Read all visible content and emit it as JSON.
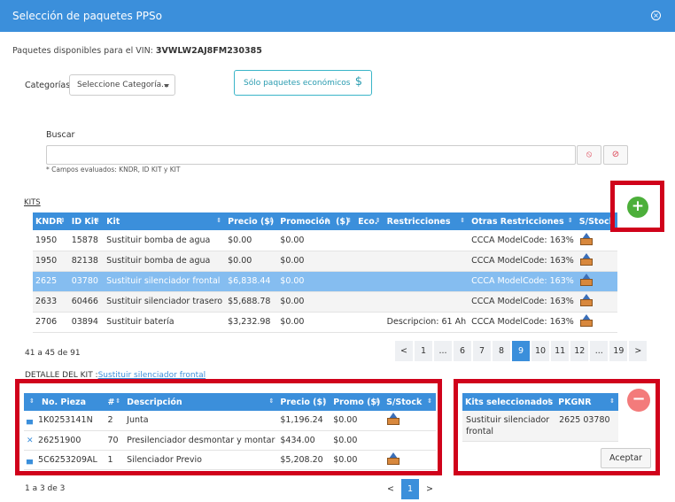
{
  "header": {
    "title": "Selección de paquetes PPSo",
    "close_glyph": "×"
  },
  "vin": {
    "label": "Paquetes disponibles para el VIN:",
    "value": "3VWLW2AJ8FM230385"
  },
  "categorias": {
    "label": "Categorías",
    "placeholder": "Seleccione Categoría..."
  },
  "eco_button": {
    "label": "Sólo paquetes económicos",
    "icon": "dollar-icon"
  },
  "buscar": {
    "label": "Buscar",
    "note": "* Campos evaluados: KNDR, ID KIT y KIT",
    "clear_glyph": "⦸",
    "cancel_glyph": "⊘"
  },
  "kits": {
    "label": "KITS",
    "columns": [
      "KNDR",
      "ID Kit",
      "Kit",
      "Precio ($)",
      "Promoción",
      "($)",
      "Eco.",
      "Restricciones",
      "Otras Restricciones",
      "S/Stock"
    ],
    "rows": [
      [
        "1950",
        "15878",
        "Sustituir bomba de agua",
        "$0.00",
        "$0.00",
        "",
        "",
        "",
        "CCCA ModelCode: 163%"
      ],
      [
        "1950",
        "82138",
        "Sustituir bomba de agua",
        "$0.00",
        "$0.00",
        "",
        "",
        "",
        "CCCA ModelCode: 163%"
      ],
      [
        "2625",
        "03780",
        "Sustituir silenciador frontal",
        "$6,838.44",
        "$0.00",
        "",
        "",
        "",
        "CCCA ModelCode: 163%"
      ],
      [
        "2633",
        "60466",
        "Sustituir silenciador trasero",
        "$5,688.78",
        "$0.00",
        "",
        "",
        "",
        "CCCA ModelCode: 163%"
      ],
      [
        "2706",
        "03894",
        "Sustituir batería",
        "$3,232.98",
        "$0.00",
        "",
        "",
        "Descripcion: 61 Ah",
        "CCCA ModelCode: 163%"
      ]
    ],
    "selected_row": 2,
    "count": "41 a 45 de 91",
    "pages": [
      "<",
      "1",
      "...",
      "6",
      "7",
      "8",
      "9",
      "10",
      "11",
      "12",
      "...",
      "19",
      ">"
    ],
    "active_page": "9",
    "add_glyph": "+"
  },
  "detalle": {
    "label": "DETALLE DEL KIT :",
    "kit_name": "Sustituir silenciador frontal",
    "columns": [
      "No. Pieza",
      "#",
      "Descripción",
      "Precio ($)",
      "Promo ($)",
      "S/Stock"
    ],
    "rows": [
      {
        "icon": "engine-icon",
        "pieza": "1K0253141N",
        "qty": "2",
        "desc": "Junta",
        "precio": "$1,196.24",
        "promo": "$0.00",
        "stock": true
      },
      {
        "icon": "tools-icon",
        "pieza": "26251900",
        "qty": "70",
        "desc": "Presilenciador desmontar y montar",
        "precio": "$434.00",
        "promo": "$0.00",
        "stock": false
      },
      {
        "icon": "engine-icon",
        "pieza": "5C6253209AL",
        "qty": "1",
        "desc": "Silenciador Previo",
        "precio": "$5,208.20",
        "promo": "$0.00",
        "stock": true
      }
    ],
    "count": "1 a 3 de 3",
    "pages": [
      "<",
      "1",
      ">"
    ],
    "active_page": "1"
  },
  "seleccionados": {
    "columns": [
      "Kits seleccionados",
      "PKGNR"
    ],
    "rows": [
      {
        "kit": "Sustituir silenciador frontal",
        "pkgnr": "2625 03780"
      }
    ],
    "accept_label": "Aceptar",
    "remove_glyph": "−"
  },
  "sort_glyph": "⇕",
  "colors": {
    "header": "#3b8fdb",
    "highlight": "#d0021b",
    "add": "#4caf3a",
    "remove": "#f37b7b"
  }
}
